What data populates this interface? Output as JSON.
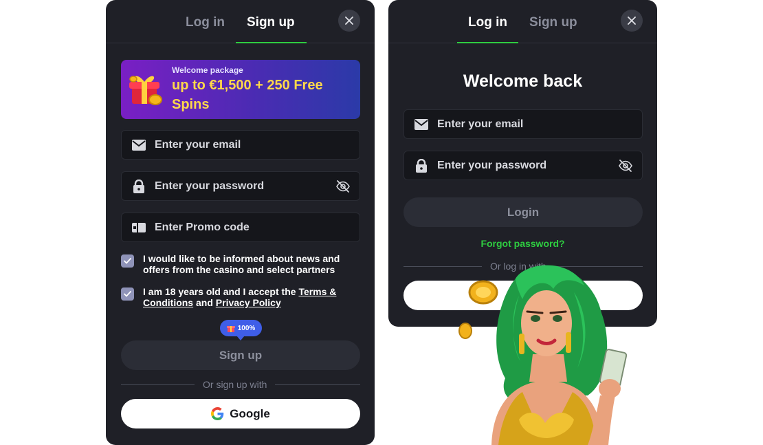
{
  "signup_panel": {
    "tabs": {
      "login": "Log in",
      "signup": "Sign up"
    },
    "banner": {
      "small": "Welcome package",
      "big": "up to €1,500 + 250 Free Spins"
    },
    "fields": {
      "email": "Enter your email",
      "password": "Enter your password",
      "promo": "Enter Promo code"
    },
    "checks": {
      "news": "I would like to be informed about news and offers from the casino and select partners",
      "age_prefix": "I am 18 years old and I accept the ",
      "terms": "Terms & Conditions",
      "and": " and ",
      "privacy": "Privacy Policy"
    },
    "badge": "100%",
    "submit": "Sign up",
    "divider": "Or sign up with",
    "google": "Google"
  },
  "login_panel": {
    "tabs": {
      "login": "Log in",
      "signup": "Sign up"
    },
    "title": "Welcome back",
    "fields": {
      "email": "Enter your email",
      "password": "Enter your password"
    },
    "submit": "Login",
    "forgot": "Forgot password?",
    "divider": "Or log in with"
  },
  "colors": {
    "panel_bg": "#1f2027",
    "accent_green": "#2ecc40",
    "promo_yellow": "#ffd84a",
    "badge_blue": "#3f5ee8"
  },
  "icons": [
    "close-icon",
    "gift-icon",
    "mail-icon",
    "lock-icon",
    "eye-off-icon",
    "promo-icon",
    "check-icon",
    "google-icon"
  ]
}
